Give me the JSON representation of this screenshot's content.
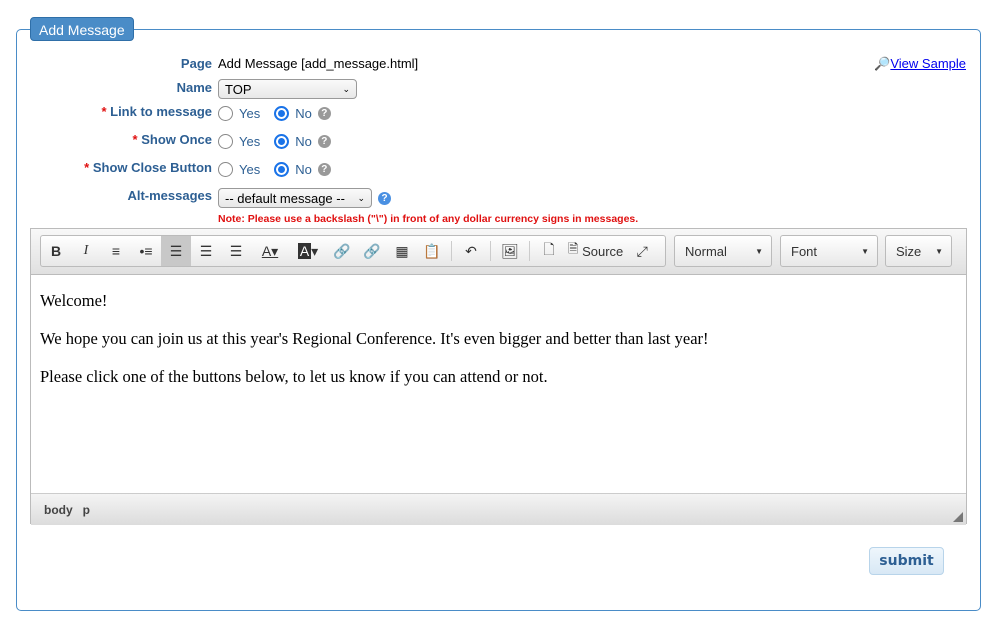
{
  "legend": "Add Message",
  "view_sample": "View Sample",
  "fields": {
    "page": {
      "label": "Page",
      "value": "Add Message [add_message.html]"
    },
    "name": {
      "label": "Name",
      "value": "TOP"
    },
    "link": {
      "label": "Link to message",
      "yes": "Yes",
      "no": "No",
      "selected": "No"
    },
    "once": {
      "label": "Show Once",
      "yes": "Yes",
      "no": "No",
      "selected": "No"
    },
    "close": {
      "label": "Show Close Button",
      "yes": "Yes",
      "no": "No",
      "selected": "No"
    },
    "alt": {
      "label": "Alt-messages",
      "value": "-- default message --"
    },
    "required_mark": "*"
  },
  "note": "Note: Please use a backslash (\"\\\") in front of any dollar currency signs in messages.",
  "toolbar": {
    "source": "Source",
    "format": "Normal",
    "font": "Font",
    "size": "Size"
  },
  "content": [
    "Welcome!",
    "We hope you can join us at this year's Regional Conference. It's even bigger and better than last year!",
    "Please click one of the buttons below, to let us know if you can attend or not."
  ],
  "footer": {
    "path": [
      "body",
      "p"
    ]
  },
  "submit": "submit"
}
